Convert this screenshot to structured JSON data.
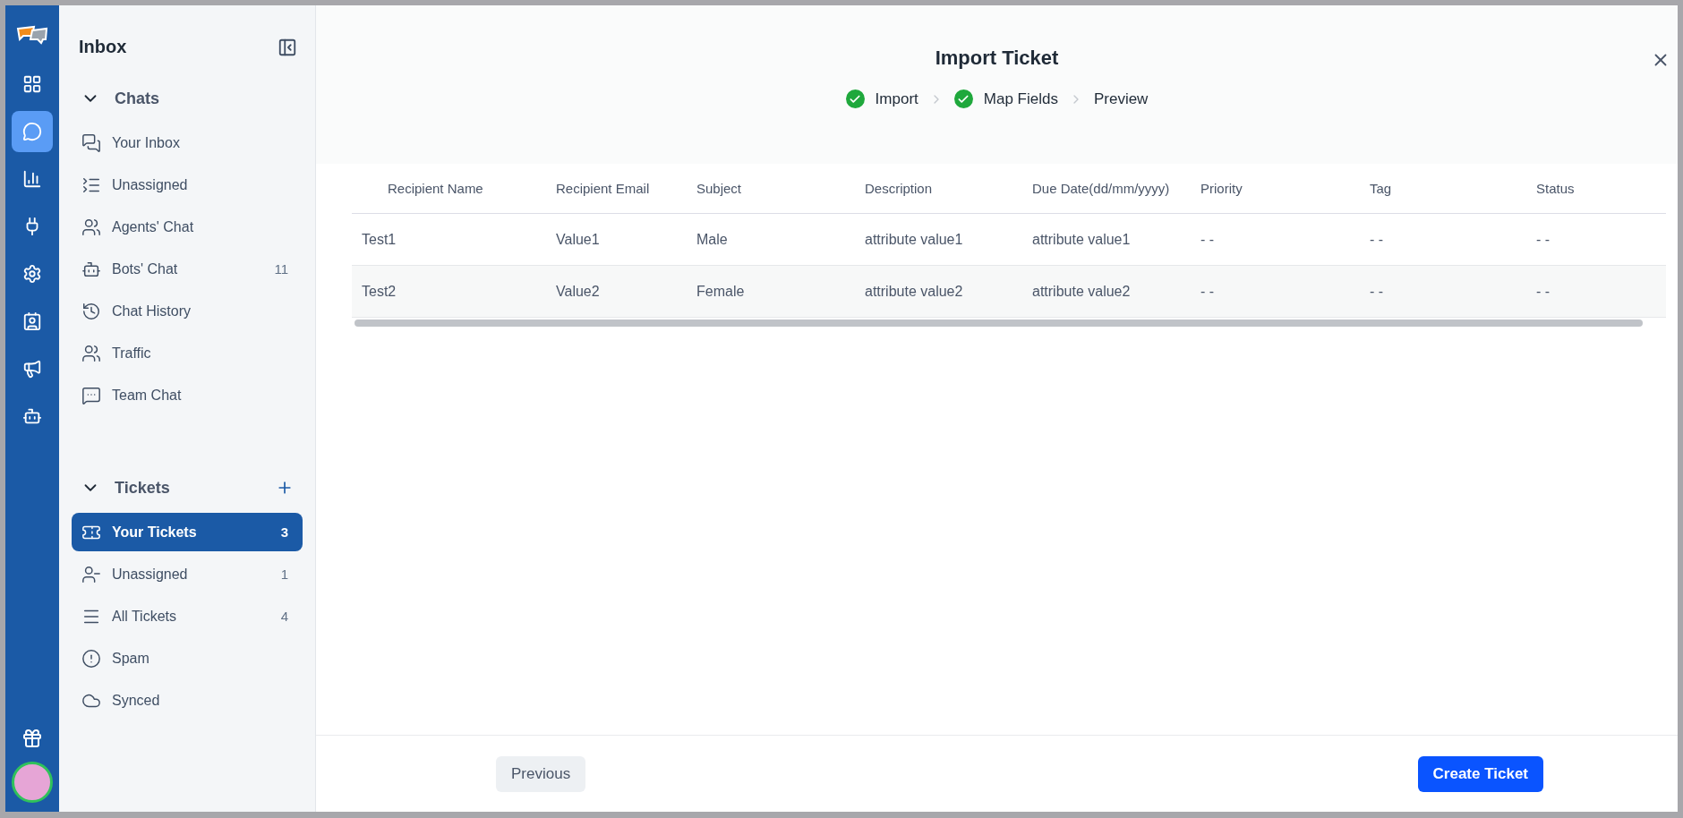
{
  "rail": {
    "items": [
      {
        "selected": false
      },
      {
        "selected": true
      },
      {
        "selected": false
      },
      {
        "selected": false
      },
      {
        "selected": false
      },
      {
        "selected": false
      },
      {
        "selected": false
      },
      {
        "selected": false
      }
    ]
  },
  "sidebar": {
    "title": "Inbox",
    "sections": [
      {
        "title": "Chats",
        "expanded": true,
        "items": [
          {
            "label": "Your Inbox",
            "selected": false
          },
          {
            "label": "Unassigned",
            "selected": false
          },
          {
            "label": "Agents' Chat",
            "selected": false
          },
          {
            "label": "Bots' Chat",
            "count": "11",
            "selected": false
          },
          {
            "label": "Chat History",
            "selected": false
          },
          {
            "label": "Traffic",
            "selected": false
          },
          {
            "label": "Team Chat",
            "selected": false
          }
        ]
      },
      {
        "title": "Tickets",
        "expanded": true,
        "addable": true,
        "items": [
          {
            "label": "Your Tickets",
            "count": "3",
            "selected": true
          },
          {
            "label": "Unassigned",
            "count": "1",
            "selected": false
          },
          {
            "label": "All Tickets",
            "count": "4",
            "selected": false
          },
          {
            "label": "Spam",
            "selected": false
          },
          {
            "label": "Synced",
            "selected": false
          }
        ]
      }
    ]
  },
  "dialog": {
    "title": "Import Ticket",
    "steps": [
      {
        "label": "Import",
        "done": true
      },
      {
        "label": "Map Fields",
        "done": true
      },
      {
        "label": "Preview",
        "done": false
      }
    ],
    "table": {
      "columns": [
        "Recipient Name",
        "Recipient Email",
        "Subject",
        "Description",
        "Due Date(dd/mm/yyyy)",
        "Priority",
        "Tag",
        "Status"
      ],
      "rows": [
        [
          "Test1",
          "Value1",
          "Male",
          "attribute value1",
          "attribute value1",
          "- -",
          "- -",
          "- -"
        ],
        [
          "Test2",
          "Value2",
          "Female",
          "attribute value2",
          "attribute value2",
          "- -",
          "- -",
          "- -"
        ]
      ]
    },
    "buttons": {
      "previous": "Previous",
      "create": "Create Ticket"
    }
  }
}
